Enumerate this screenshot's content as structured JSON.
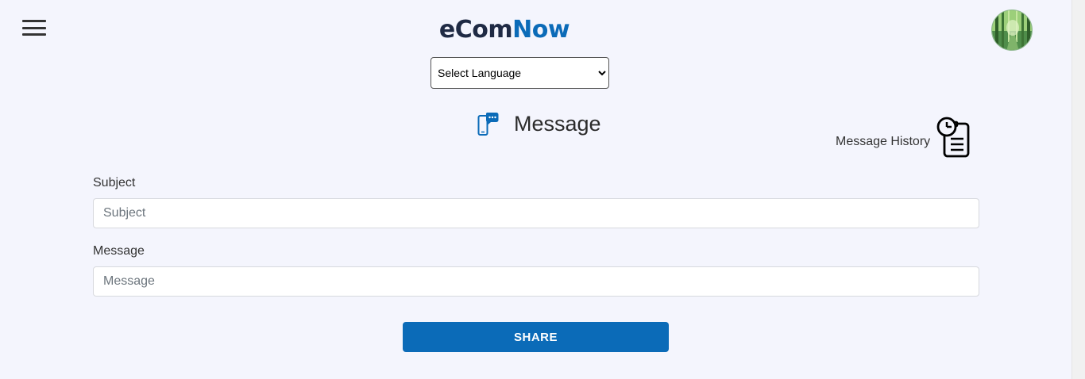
{
  "header": {
    "logo_part1": "eCom",
    "logo_part2": "Now",
    "menu_icon": "hamburger-menu-icon",
    "avatar_icon": "user-avatar-forest"
  },
  "language": {
    "selected": "Select Language"
  },
  "page": {
    "title": "Message",
    "title_icon": "phone-chat-icon",
    "history_label": "Message History",
    "history_icon": "clipboard-clock-icon"
  },
  "form": {
    "subject_label": "Subject",
    "subject_placeholder": "Subject",
    "message_label": "Message",
    "message_placeholder": "Message",
    "submit_label": "SHARE"
  },
  "colors": {
    "brand": "#0b6bb8",
    "background": "#f4f5fd"
  }
}
